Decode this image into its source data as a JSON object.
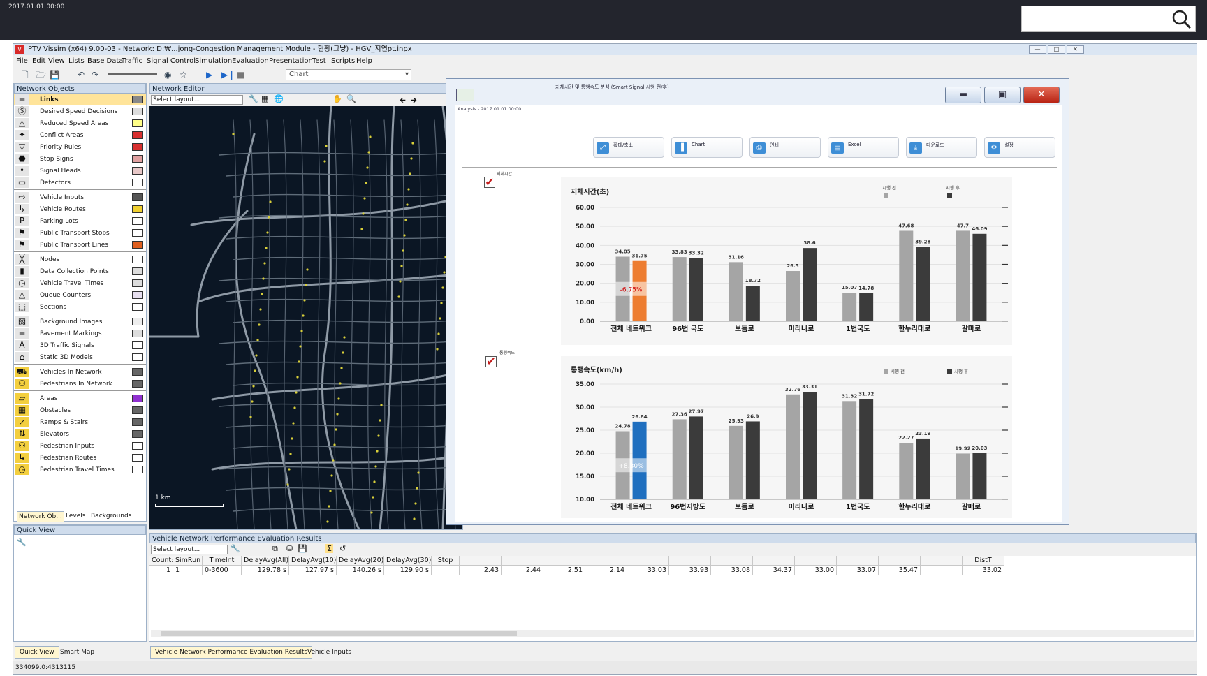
{
  "topbar": {
    "datetime": "2017.01.01  00:00"
  },
  "app": {
    "title": "PTV Vissim (x64) 9.00-03 - Network: D:₩...jong-Congestion Management Module - 현황(그냥) - HGV_지연pt.inpx",
    "icon": "vissim-icon"
  },
  "menu": [
    "File",
    "Edit",
    "View",
    "Lists",
    "Base Data",
    "Traffic",
    "Signal Control",
    "Simulation",
    "Evaluation",
    "Presentation",
    "Test",
    "Scripts",
    "Help"
  ],
  "toolbar": {
    "combo": "Chart"
  },
  "network_objects": {
    "title": "Network Objects",
    "items": [
      {
        "label": "Links",
        "icon": "link-icon",
        "selected": true,
        "group": 0,
        "color": "#888888"
      },
      {
        "label": "Desired Speed Decisions",
        "icon": "speed-decision-icon",
        "group": 0,
        "color": "#dddddd"
      },
      {
        "label": "Reduced Speed Areas",
        "icon": "reduced-speed-icon",
        "group": 0,
        "color": "#ffff88"
      },
      {
        "label": "Conflict Areas",
        "icon": "conflict-icon",
        "group": 0,
        "color": "#d83030"
      },
      {
        "label": "Priority Rules",
        "icon": "priority-icon",
        "group": 0,
        "color": "#d83030"
      },
      {
        "label": "Stop Signs",
        "icon": "stop-sign-icon",
        "group": 0,
        "color": "#e0a0a0"
      },
      {
        "label": "Signal Heads",
        "icon": "signal-head-icon",
        "group": 0,
        "color": "#e8c8c8"
      },
      {
        "label": "Detectors",
        "icon": "detector-icon",
        "group": 0,
        "color": "#ffffff"
      },
      {
        "label": "Vehicle Inputs",
        "icon": "vehicle-input-icon",
        "group": 1,
        "color": "#555555"
      },
      {
        "label": "Vehicle Routes",
        "icon": "vehicle-route-icon",
        "group": 1,
        "color": "#f0d030"
      },
      {
        "label": "Parking Lots",
        "icon": "parking-icon",
        "group": 1,
        "color": "#ffffff"
      },
      {
        "label": "Public Transport Stops",
        "icon": "pt-stop-icon",
        "group": 1,
        "color": "#ffffff"
      },
      {
        "label": "Public Transport Lines",
        "icon": "pt-line-icon",
        "group": 1,
        "color": "#e06020"
      },
      {
        "label": "Nodes",
        "icon": "node-icon",
        "group": 2,
        "color": "#ffffff"
      },
      {
        "label": "Data Collection Points",
        "icon": "data-point-icon",
        "group": 2,
        "color": "#dddddd"
      },
      {
        "label": "Vehicle Travel Times",
        "icon": "travel-time-icon",
        "group": 2,
        "color": "#dddddd"
      },
      {
        "label": "Queue Counters",
        "icon": "queue-counter-icon",
        "group": 2,
        "color": "#e8e0f0"
      },
      {
        "label": "Sections",
        "icon": "section-icon",
        "group": 2,
        "color": "#ffffff"
      },
      {
        "label": "Background Images",
        "icon": "background-image-icon",
        "group": 3,
        "color": "#eeeeee"
      },
      {
        "label": "Pavement Markings",
        "icon": "pavement-marking-icon",
        "group": 3,
        "color": "#dddddd"
      },
      {
        "label": "3D Traffic Signals",
        "icon": "traffic-signal-3d-icon",
        "group": 3,
        "color": "#ffffff"
      },
      {
        "label": "Static 3D Models",
        "icon": "static-model-icon",
        "group": 3,
        "color": "#ffffff"
      },
      {
        "label": "Vehicles In Network",
        "icon": "vehicle-icon",
        "group": 4,
        "color": "#666666"
      },
      {
        "label": "Pedestrians In Network",
        "icon": "pedestrian-icon",
        "group": 4,
        "color": "#666666"
      },
      {
        "label": "Areas",
        "icon": "area-icon",
        "group": 5,
        "color": "#9030d0"
      },
      {
        "label": "Obstacles",
        "icon": "obstacle-icon",
        "group": 5,
        "color": "#666666"
      },
      {
        "label": "Ramps & Stairs",
        "icon": "ramp-icon",
        "group": 5,
        "color": "#666666"
      },
      {
        "label": "Elevators",
        "icon": "elevator-icon",
        "group": 5,
        "color": "#666666"
      },
      {
        "label": "Pedestrian Inputs",
        "icon": "pedestrian-input-icon",
        "group": 5,
        "color": "#ffffff"
      },
      {
        "label": "Pedestrian Routes",
        "icon": "pedestrian-route-icon",
        "group": 5,
        "color": "#ffffff"
      },
      {
        "label": "Pedestrian Travel Times",
        "icon": "pedestrian-travel-icon",
        "group": 5,
        "color": "#ffffff"
      }
    ],
    "tabs": [
      "Network Ob...",
      "Levels",
      "Backgrounds"
    ]
  },
  "quick_view": {
    "title": "Quick View",
    "tabs": [
      "Quick View",
      "Smart Map"
    ]
  },
  "network_editor": {
    "title": "Network Editor",
    "layout_placeholder": "Select layout...",
    "scale": "1 km"
  },
  "results": {
    "title": "Vehicle Network Performance Evaluation Results",
    "layout_placeholder": "Select layout...",
    "columns": [
      "Count:",
      "SimRun",
      "TimeInt",
      "DelayAvg(All)",
      "DelayAvg(10)",
      "DelayAvg(20)",
      "DelayAvg(30)",
      "Stop",
      "",
      "",
      "",
      "",
      "",
      "",
      "",
      "",
      "",
      "",
      "",
      "",
      "DistT"
    ],
    "row": [
      "1",
      "1",
      "0-3600",
      "129.78 s",
      "127.97 s",
      "140.26 s",
      "129.90 s",
      "",
      "2.43",
      "2.44",
      "2.51",
      "2.14",
      "33.03",
      "33.93",
      "33.08",
      "34.37",
      "33.00",
      "33.07",
      "35.47",
      "",
      "33.02"
    ]
  },
  "bottom_tabs": [
    "Vehicle Network Performance Evaluation Results",
    "Vehicle Inputs"
  ],
  "status": "334099.0:4313115",
  "dialog": {
    "title": "지체시간 및 통행속도 분석 (Smart Signal 시행 전/후)",
    "analysis": "Analysis - 2017.01.01  00:00",
    "buttons": [
      {
        "label": "확대/축소",
        "icon": "zoom-icon"
      },
      {
        "label": "Chart",
        "icon": "chart-icon"
      },
      {
        "label": "인쇄",
        "icon": "print-icon"
      },
      {
        "label": "Excel",
        "icon": "excel-icon"
      },
      {
        "label": "다운로드",
        "icon": "download-icon"
      },
      {
        "label": "설정",
        "icon": "settings-icon"
      }
    ],
    "check1_label": "지체시간",
    "check2_label": "통행속도"
  },
  "chart_data": [
    {
      "type": "bar",
      "ylabel": "지체시간(초)",
      "ylim": [
        0,
        60
      ],
      "yticks": [
        "60.00",
        "50.00",
        "40.00",
        "30.00",
        "20.00",
        "10.00",
        "0.00"
      ],
      "categories": [
        "전체 네트워크",
        "96번 국도",
        "보듬로",
        "미리내로",
        "1번국도",
        "한누리대로",
        "갈마로"
      ],
      "series": [
        {
          "name": "시행 전",
          "values": [
            34.05,
            33.83,
            31.16,
            26.5,
            15.07,
            47.68,
            47.7
          ]
        },
        {
          "name": "시행 후",
          "values": [
            31.75,
            33.32,
            18.72,
            38.6,
            14.78,
            39.28,
            46.09
          ]
        }
      ],
      "annotation": "-6.75%",
      "highlight_color": "#ed7d31",
      "before_color": "#a5a5a5",
      "after_color": "#3b3b3b"
    },
    {
      "type": "bar",
      "ylabel": "통행속도(km/h)",
      "ylim": [
        10,
        35
      ],
      "yticks": [
        "35.00",
        "30.00",
        "25.00",
        "20.00",
        "15.00",
        "10.00"
      ],
      "categories": [
        "전체 네트워크",
        "96번지방도",
        "보듬로",
        "미리내로",
        "1번국도",
        "한누리대로",
        "갈매로"
      ],
      "series": [
        {
          "name": "시행 전",
          "values": [
            24.78,
            27.36,
            25.93,
            32.76,
            31.32,
            22.27,
            19.92
          ]
        },
        {
          "name": "시행 후",
          "values": [
            26.84,
            27.97,
            26.9,
            33.31,
            31.72,
            23.19,
            20.03
          ]
        }
      ],
      "annotation": "+8.30%",
      "highlight_color": "#1f6fbf",
      "before_color": "#a5a5a5",
      "after_color": "#3b3b3b"
    }
  ]
}
